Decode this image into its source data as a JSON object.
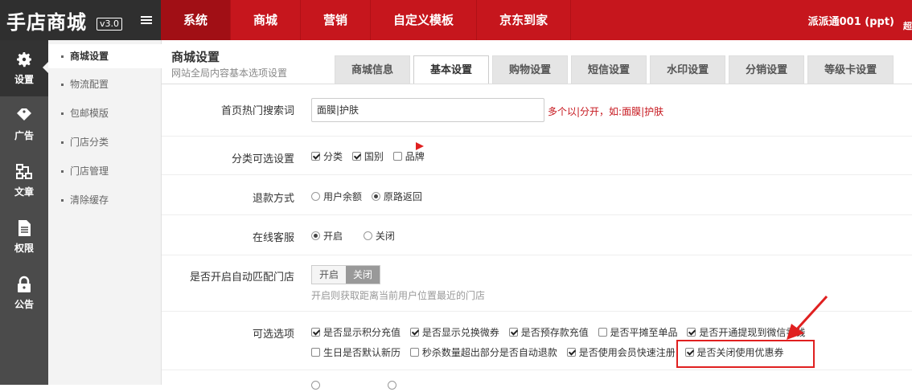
{
  "header": {
    "logo_text": "手店商城",
    "version": "v3.0",
    "nav": [
      "系统",
      "商城",
      "营销",
      "自定义模板",
      "京东到家"
    ],
    "active_nav": 0,
    "user": "派派通001 (ppt)",
    "user_extra": "超"
  },
  "iconbar": [
    {
      "label": "设置",
      "icon": "gear-icon"
    },
    {
      "label": "广告",
      "icon": "tag-icon"
    },
    {
      "label": "文章",
      "icon": "sitemap-icon"
    },
    {
      "label": "权限",
      "icon": "document-icon"
    },
    {
      "label": "公告",
      "icon": "lock-icon"
    }
  ],
  "subnav": [
    "商城设置",
    "物流配置",
    "包邮模版",
    "门店分类",
    "门店管理",
    "清除缓存"
  ],
  "page": {
    "title": "商城设置",
    "subtitle": "网站全局内容基本选项设置",
    "tabs": [
      "商城信息",
      "基本设置",
      "购物设置",
      "短信设置",
      "水印设置",
      "分销设置",
      "等级卡设置"
    ],
    "active_tab": 1
  },
  "form": {
    "hot_search": {
      "label": "首页热门搜索词",
      "value": "面膜|护肤",
      "hint": "多个以|分开，如:面膜|护肤"
    },
    "category": {
      "label": "分类可选设置",
      "options": [
        {
          "text": "分类",
          "checked": true
        },
        {
          "text": "国别",
          "checked": true
        },
        {
          "text": "品牌",
          "checked": false
        }
      ]
    },
    "refund": {
      "label": "退款方式",
      "options": [
        {
          "text": "用户余额",
          "selected": false
        },
        {
          "text": "原路返回",
          "selected": true
        }
      ]
    },
    "service": {
      "label": "在线客服",
      "options": [
        {
          "text": "开启",
          "selected": true
        },
        {
          "text": "关闭",
          "selected": false
        }
      ]
    },
    "auto_store": {
      "label": "是否开启自动匹配门店",
      "on_text": "开启",
      "off_text": "关闭",
      "hint": "开启则获取距离当前用户位置最近的门店"
    },
    "optional": {
      "label": "可选选项",
      "line1": [
        {
          "text": "是否显示积分充值",
          "checked": true
        },
        {
          "text": "是否显示兑换微券",
          "checked": true
        },
        {
          "text": "是否预存款充值",
          "checked": true
        },
        {
          "text": "是否平摊至单品",
          "checked": false
        },
        {
          "text": "是否开通提现到微信零钱",
          "checked": true
        }
      ],
      "line2": [
        {
          "text": "生日是否默认新历",
          "checked": false
        },
        {
          "text": "秒杀数量超出部分是否自动退款",
          "checked": false
        },
        {
          "text": "是否使用会员快速注册",
          "checked": true
        },
        {
          "text": "是否关闭使用优惠券",
          "checked": true
        }
      ]
    }
  },
  "colors": {
    "brand": "#c6161d",
    "annotation": "#e02020"
  }
}
